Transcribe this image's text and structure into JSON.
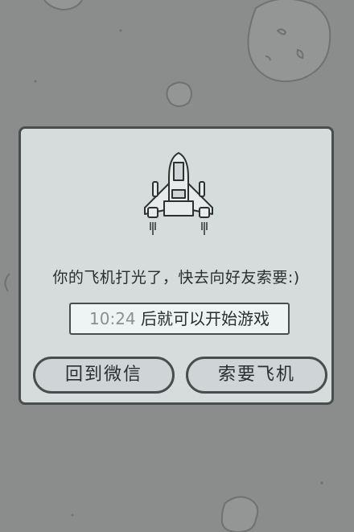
{
  "dialog": {
    "message": "你的飞机打光了，快去向好友索要:)",
    "timer": {
      "time": "10:24",
      "suffix": " 后就可以开始游戏"
    },
    "buttons": {
      "back_label": "回到微信",
      "ask_label": "索要飞机"
    }
  },
  "icons": {
    "plane": "plane-icon"
  },
  "colors": {
    "background": "#8b8d8c",
    "dialog_bg": "#d6dcdc",
    "border": "#4a4d4d"
  }
}
